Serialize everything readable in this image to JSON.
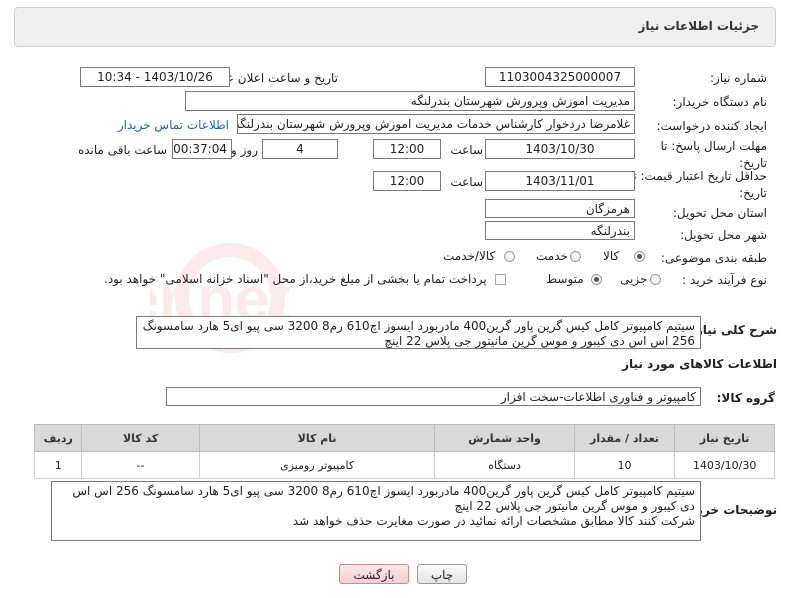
{
  "header": {
    "title": "جزئیات اطلاعات نیاز"
  },
  "form": {
    "need_number_label": "شماره نیاز:",
    "need_number": "1103004325000007",
    "announce_label": "تاریخ و ساعت اعلان عمومی:",
    "announce_value": "1403/10/26 - 10:34",
    "buyer_label": "نام دستگاه خریدار:",
    "buyer_value": "مدیریت اموزش وپرورش شهرستان بندرلنگه",
    "creator_label": "ایجاد کننده درخواست:",
    "creator_value": "غلامرضا دردخوار کارشناس خدمات مدیریت اموزش وپرورش شهرستان بندرلنگه",
    "contact_link": "اطلاعات تماس خریدار",
    "reply_deadline_label": "مهلت ارسال پاسخ: تا تاریخ:",
    "reply_date": "1403/10/30",
    "time_label": "ساعت",
    "reply_time": "12:00",
    "days_value": "4",
    "days_label": "روز و",
    "remaining_time": "00:37:04",
    "remaining_label": "ساعت باقی مانده",
    "price_deadline_label": "حداقل تاریخ اعتبار قیمت: تا تاریخ:",
    "price_date": "1403/11/01",
    "price_time": "12:00",
    "province_label": "استان محل تحویل:",
    "province_value": "هرمزگان",
    "city_label": "شهر محل تحویل:",
    "city_value": "بندرلنگه",
    "category_label": "طبقه بندی موضوعی:",
    "category_options": [
      "کالا",
      "خدمت",
      "کالا/خدمت"
    ],
    "category_selected": "کالا",
    "process_label": "نوع فرآیند خرید :",
    "process_options": [
      "جزیی",
      "متوسط"
    ],
    "process_note": "پرداخت تمام یا بخشی از مبلغ خرید،از محل \"اسناد خزانه اسلامی\" خواهد بود.",
    "general_desc_label": "شرح کلی نیاز:",
    "general_desc_line1": "سیتیم کامپیوتر کامل کیس گرین پاور گرین400 مادربورد ایسوز اچ610 رم8 3200 سی پیو ای5 هارد سامسونگ",
    "general_desc_line2": "256 اس اس دی کیبور و موس گرین مانیتور جی پلاس 22 اینچ"
  },
  "goods": {
    "section_title": "اطلاعات کالاهای مورد نیاز",
    "group_label": "گروه کالا:",
    "group_value": "کامپیوتر و فناوری اطلاعات-سخت افزار",
    "columns": [
      "ردیف",
      "کد کالا",
      "نام کالا",
      "واحد شمارش",
      "تعداد / مقدار",
      "تاریخ نیاز"
    ],
    "rows": [
      {
        "row": "1",
        "code": "--",
        "name": "کامپیوتر رومیزی",
        "unit": "دستگاه",
        "qty": "10",
        "date": "1403/10/30"
      }
    ]
  },
  "buyer_notes": {
    "label": "توضیحات خریدار:",
    "line1": "سیتیم کامپیوتر کامل کیس گرین پاور گرین400 مادربورد ایسوز اچ610 رم8 3200 سی پیو ای5 هارد سامسونگ 256 اس اس",
    "line2": "دی کیبور و موس گرین مانیتور جی پلاس 22 اینچ",
    "line3": "شرکت کنند کالا مطابق مشخصات ارائه نمائید در صورت مغایرت حذف خواهد شد"
  },
  "buttons": {
    "print": "چاپ",
    "back": "بازگشت"
  },
  "watermark": {
    "text": "AriaTender.net"
  }
}
